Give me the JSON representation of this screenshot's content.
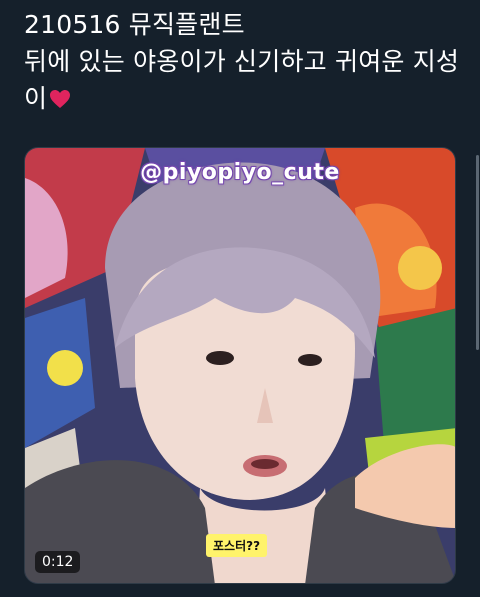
{
  "tweet": {
    "lines": [
      "210516 뮤직플랜트",
      "뒤에 있는 야옹이가 신기하고 귀여운 지성",
      "이"
    ]
  },
  "icons": {
    "heart": "red-heart-icon"
  },
  "media": {
    "watermark": "@piyopiyo_cute",
    "caption": "포스터??",
    "duration": "0:12"
  },
  "colors": {
    "background": "#15202b",
    "text": "#ffffff",
    "caption_bg": "#fff36b",
    "heart": "#e0245e"
  }
}
